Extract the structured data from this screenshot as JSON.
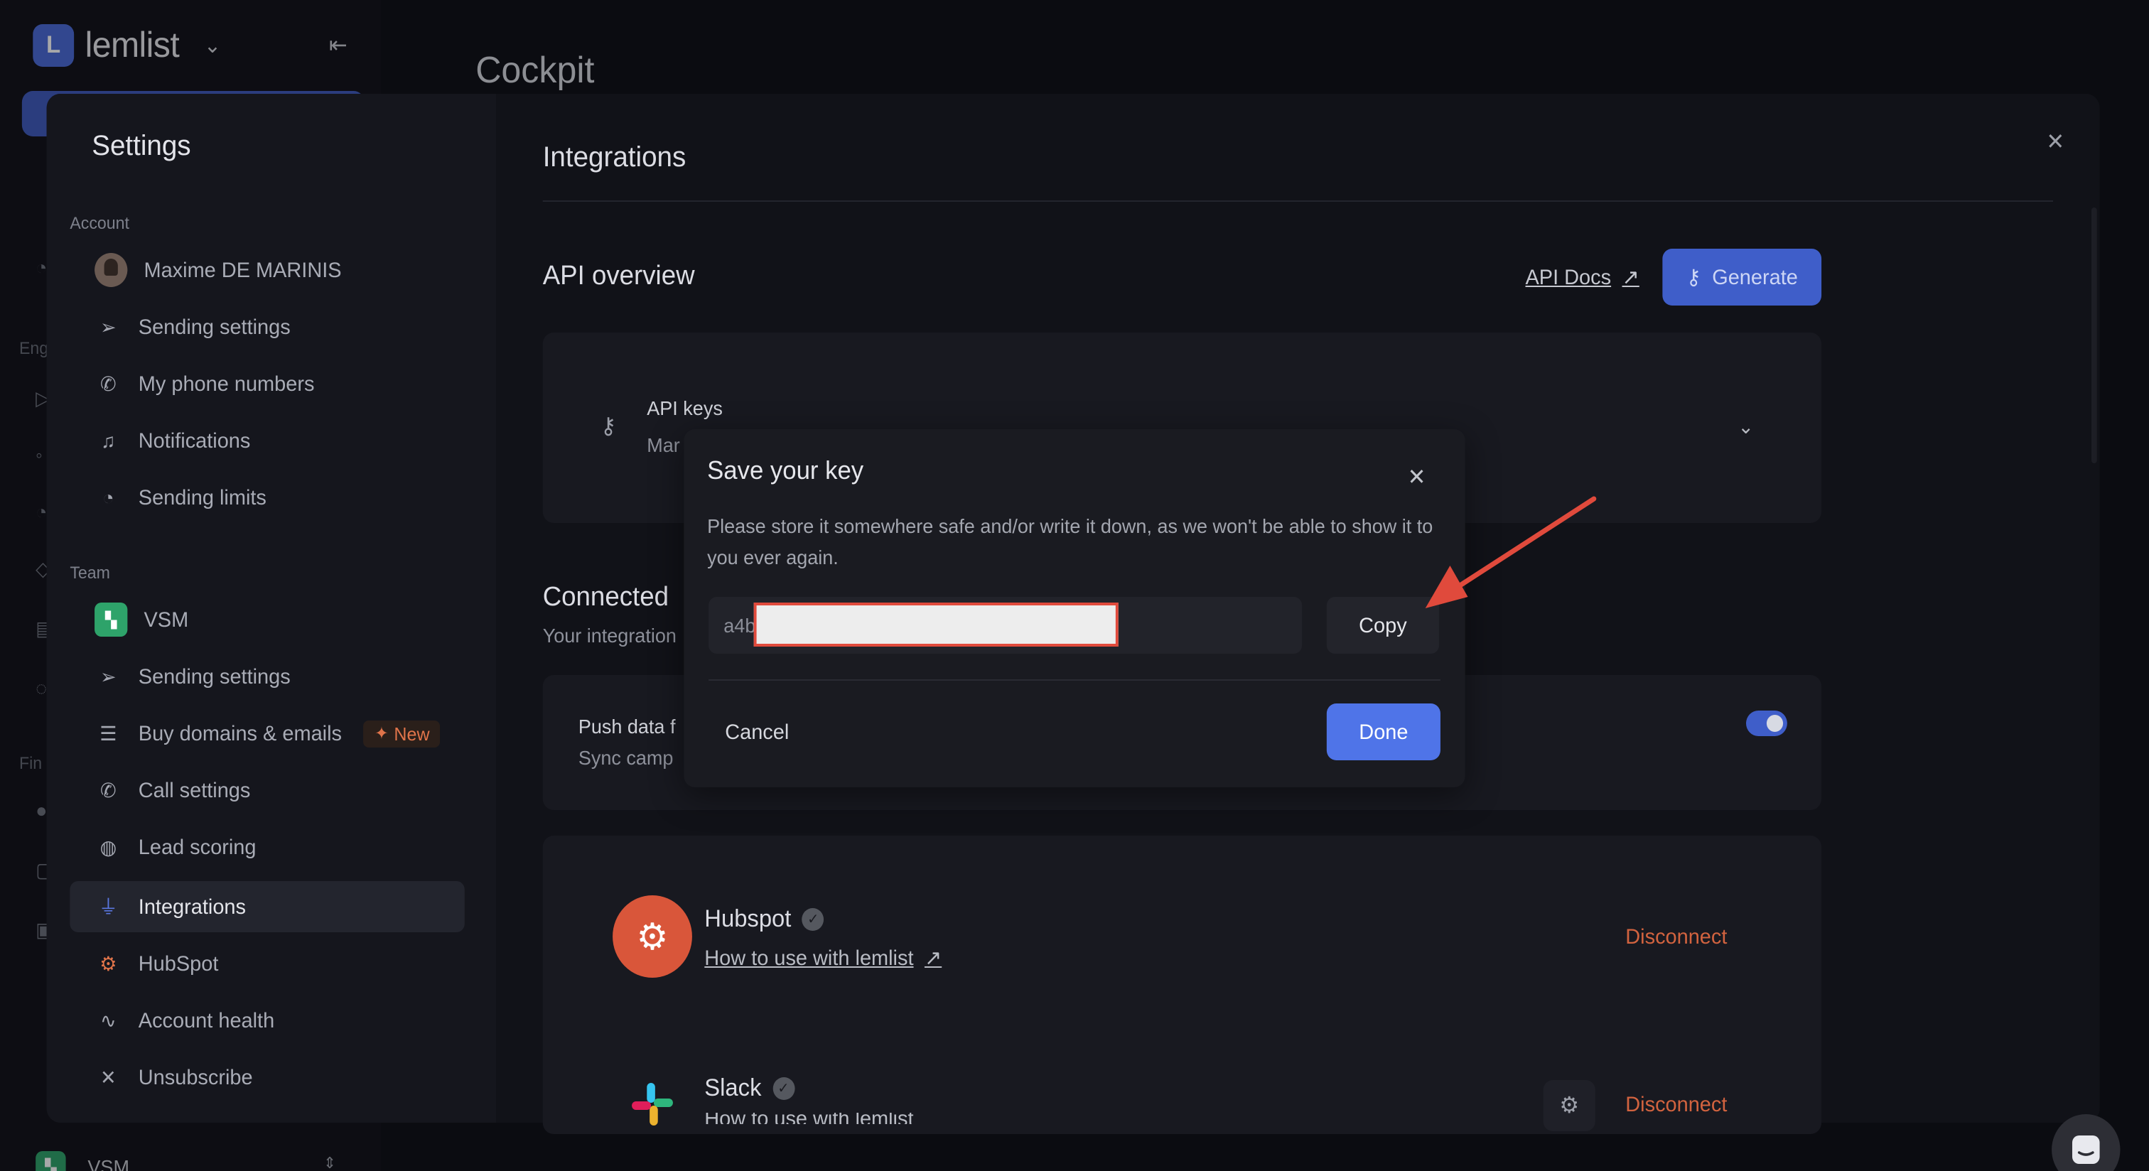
{
  "app": {
    "brand": "lemlist",
    "page_title": "Cockpit",
    "workspace_name": "VSM",
    "ghost_labels": [
      "Eng",
      "Fin"
    ]
  },
  "settings": {
    "title": "Settings",
    "account_label": "Account",
    "team_label": "Team",
    "account_items": [
      {
        "label": "Maxime DE MARINIS",
        "icon": "user-avatar"
      },
      {
        "label": "Sending settings",
        "icon": "send-icon"
      },
      {
        "label": "My phone numbers",
        "icon": "phone-icon"
      },
      {
        "label": "Notifications",
        "icon": "bell-icon"
      },
      {
        "label": "Sending limits",
        "icon": "gauge-icon"
      }
    ],
    "team_items": [
      {
        "label": "VSM",
        "icon": "vsm-logo"
      },
      {
        "label": "Sending settings",
        "icon": "send-icon"
      },
      {
        "label": "Buy domains & emails",
        "icon": "server-icon",
        "badge": "New"
      },
      {
        "label": "Call settings",
        "icon": "phone-icon"
      },
      {
        "label": "Lead scoring",
        "icon": "flame-icon"
      },
      {
        "label": "Integrations",
        "icon": "plug-icon",
        "active": true
      },
      {
        "label": "HubSpot",
        "icon": "hubspot-icon"
      },
      {
        "label": "Account health",
        "icon": "pulse-icon"
      },
      {
        "label": "Unsubscribe",
        "icon": "user-x-icon"
      }
    ]
  },
  "integrations": {
    "title": "Integrations",
    "api_overview": "API overview",
    "api_docs": "API Docs",
    "generate": "Generate",
    "api_keys": "API keys",
    "api_keys_sub": "Mar",
    "connected_title": "Connected",
    "connected_sub": "Your integration",
    "push_label": "Push data f",
    "push_sub": "Sync camp",
    "push_enabled": true,
    "hubspot": {
      "name": "Hubspot",
      "link": "How to use with lemlist",
      "action": "Disconnect"
    },
    "slack": {
      "name": "Slack",
      "link": "How to use with lemlist",
      "action": "Disconnect"
    }
  },
  "modal": {
    "title": "Save your key",
    "body": "Please store it somewhere safe and/or write it down, as we won't be able to show it to you ever again.",
    "key_prefix": "a4b",
    "copy": "Copy",
    "cancel": "Cancel",
    "done": "Done"
  },
  "colors": {
    "accent": "#4f74e8",
    "annotation_arrow": "#e04a3c",
    "disconnect": "#d2633f",
    "badge": "#e0744a"
  }
}
